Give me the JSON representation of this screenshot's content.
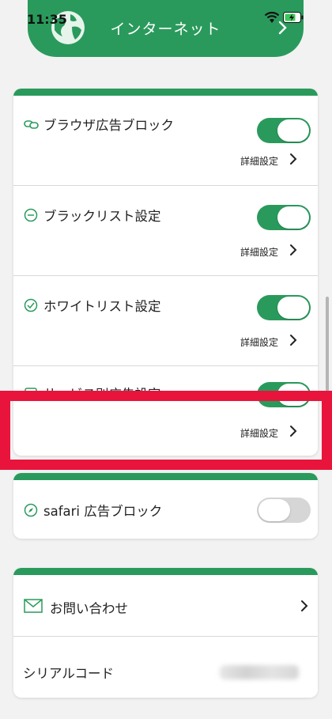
{
  "status_bar": {
    "time": "11:35"
  },
  "header": {
    "title": "インターネット"
  },
  "settings_card": {
    "rows": [
      {
        "label": "ブラウザ広告ブロック",
        "detail": "詳細設定",
        "toggle": "on"
      },
      {
        "label": "ブラックリスト設定",
        "detail": "詳細設定",
        "toggle": "on"
      },
      {
        "label": "ホワイトリスト設定",
        "detail": "詳細設定",
        "toggle": "on"
      },
      {
        "label": "サービス別広告設定",
        "detail": "詳細設定",
        "toggle": "on"
      }
    ]
  },
  "safari_card": {
    "label": "safari 広告ブロック",
    "toggle": "off"
  },
  "info_card": {
    "contact_label": "お問い合わせ",
    "serial_label": "シリアルコード"
  },
  "colors": {
    "accent": "#2a9a5c",
    "highlight": "#e8143c"
  }
}
